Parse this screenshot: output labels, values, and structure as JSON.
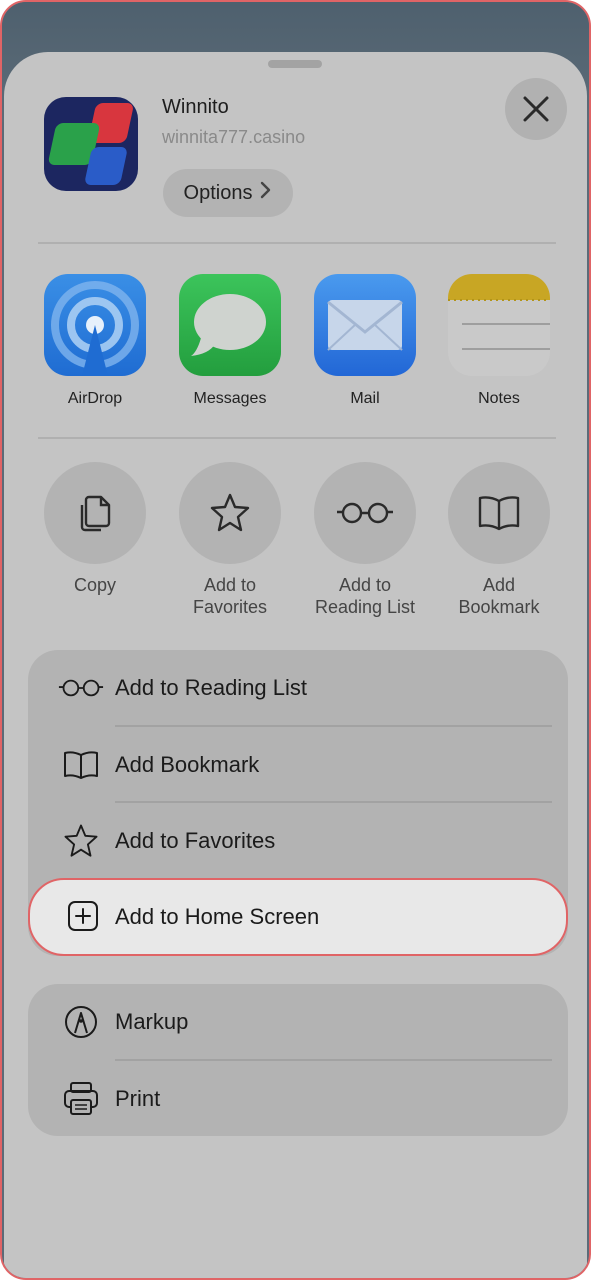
{
  "app": {
    "title": "Winnito",
    "url": "winnita777.casino",
    "options_label": "Options"
  },
  "share_targets": [
    {
      "label": "AirDrop",
      "icon": "airdrop-icon"
    },
    {
      "label": "Messages",
      "icon": "messages-icon"
    },
    {
      "label": "Mail",
      "icon": "mail-icon"
    },
    {
      "label": "Notes",
      "icon": "notes-icon"
    }
  ],
  "quick_actions": [
    {
      "label": "Copy",
      "icon": "copy-icon"
    },
    {
      "label": "Add to Favorites",
      "icon": "star-icon"
    },
    {
      "label": "Add to Reading List",
      "icon": "glasses-icon"
    },
    {
      "label": "Add Bookmark",
      "icon": "book-icon"
    }
  ],
  "menu_group_1": [
    {
      "label": "Add to Reading List",
      "icon": "glasses-icon"
    },
    {
      "label": "Add Bookmark",
      "icon": "book-icon"
    },
    {
      "label": "Add to Favorites",
      "icon": "star-icon"
    },
    {
      "label": "Add to Home Screen",
      "icon": "plus-square-icon",
      "highlighted": true
    }
  ],
  "menu_group_2": [
    {
      "label": "Markup",
      "icon": "markup-icon"
    },
    {
      "label": "Print",
      "icon": "printer-icon"
    }
  ],
  "colors": {
    "highlight_border": "#e06466",
    "sheet_bg": "#c4c4c4"
  }
}
